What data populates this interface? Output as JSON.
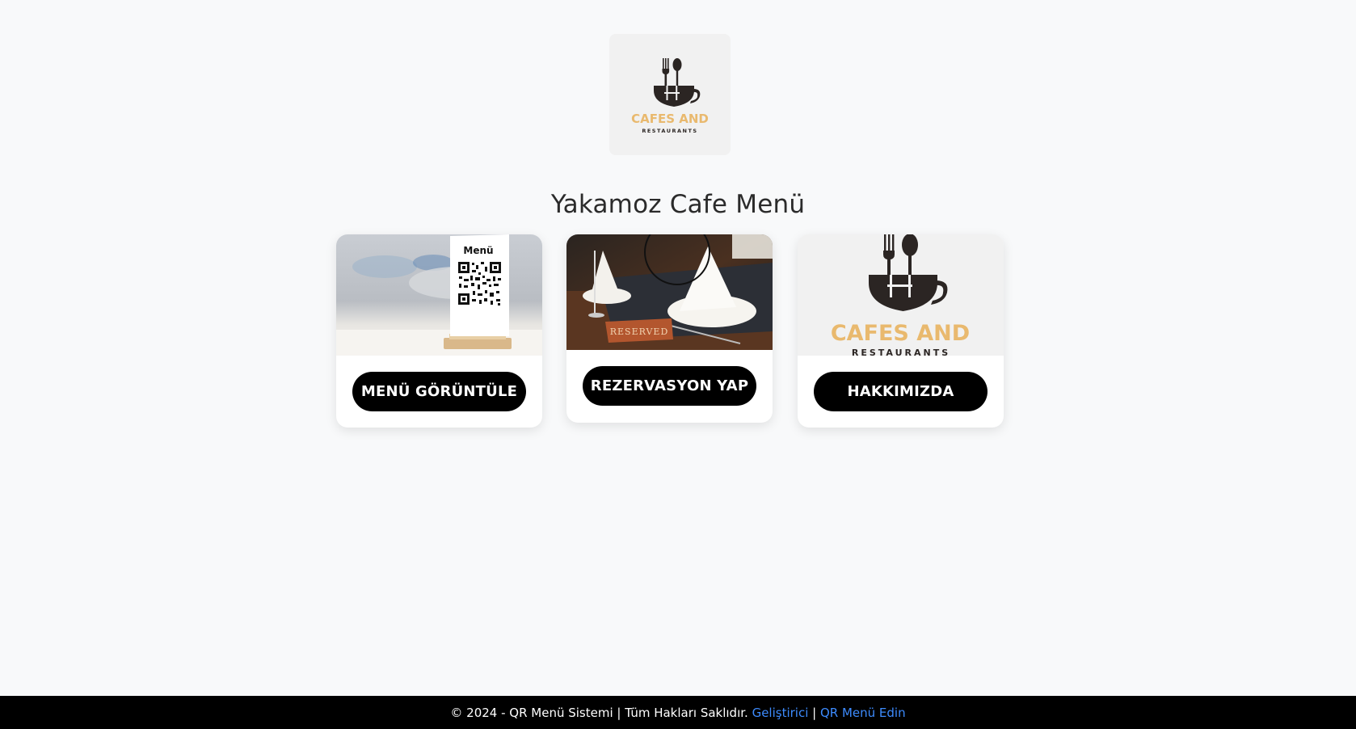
{
  "header": {
    "logo": {
      "icon": "cup-fork-spoon-icon",
      "line1": "CAFES AND",
      "line2": "RESTAURANTS"
    },
    "title": "Yakamoz Cafe Menü"
  },
  "cards": [
    {
      "image_label": "Menü",
      "image_icon": "qr-code-icon",
      "button_label": "MENÜ GÖRÜNTÜLE"
    },
    {
      "image_label": "RESERVED",
      "image_icon": "reserved-table-icon",
      "button_label": "REZERVASYON YAP"
    },
    {
      "image_icon": "cup-fork-spoon-icon",
      "image_line1": "CAFES AND",
      "image_line2": "RESTAURANTS",
      "button_label": "HAKKIMIZDA"
    }
  ],
  "footer": {
    "copyright": "© 2024 - QR Menü Sistemi | Tüm Hakları Saklıdır. ",
    "developer_link": "Geliştirici",
    "separator": " | ",
    "get_menu_link": "QR Menü Edin"
  },
  "colors": {
    "background": "#f8f9fa",
    "button": "#000000",
    "link": "#3d8bfd",
    "logo_gold": "#e9b96e",
    "logo_dark": "#2b2523"
  }
}
